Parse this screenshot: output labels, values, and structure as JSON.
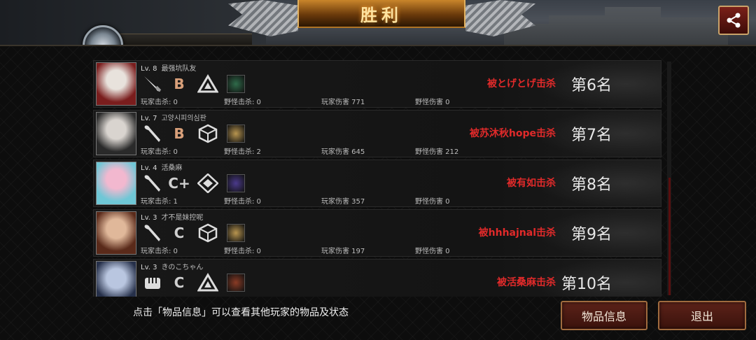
{
  "header": {
    "title": "胜利",
    "share_icon": "share-icon",
    "plate_text": "+ 胜利"
  },
  "colors": {
    "killer_text": "#e02a2a",
    "title_glow": "#ff9d2a",
    "button_bg": "#5c2219"
  },
  "players": [
    {
      "level": "Lv. 8",
      "name": "最强坑队友",
      "weapon": "knife-icon",
      "grade": "B",
      "trait": "triangle-trait-icon",
      "skill_color": "#2f6b4a",
      "player_kills": "玩家击杀: 0",
      "monster_kills": "野怪击杀: 0",
      "player_damage": "玩家伤害 771",
      "monster_damage": "野怪伤害 0",
      "killed_by": "被とげとげ击杀",
      "rank": "第6名"
    },
    {
      "level": "Lv. 7",
      "name": "고양시피의심판",
      "weapon": "bat-icon",
      "grade": "B",
      "trait": "cube-trait-icon",
      "skill_color": "#b8954f",
      "player_kills": "玩家击杀: 0",
      "monster_kills": "野怪击杀: 2",
      "player_damage": "玩家伤害 645",
      "monster_damage": "野怪伤害 212",
      "killed_by": "被苏沐秋hope击杀",
      "rank": "第7名"
    },
    {
      "level": "Lv. 4",
      "name": "活桑麻",
      "weapon": "bat-icon",
      "grade": "C+",
      "trait": "diamond-trait-icon",
      "skill_color": "#4b3a8c",
      "player_kills": "玩家击杀: 1",
      "monster_kills": "野怪击杀: 0",
      "player_damage": "玩家伤害 357",
      "monster_damage": "野怪伤害 0",
      "killed_by": "被有如击杀",
      "rank": "第8名"
    },
    {
      "level": "Lv. 3",
      "name": "才不是妹控呢",
      "weapon": "bat-icon",
      "grade": "C",
      "trait": "cube-trait-icon",
      "skill_color": "#b8954f",
      "player_kills": "玩家击杀: 0",
      "monster_kills": "野怪击杀: 0",
      "player_damage": "玩家伤害 197",
      "monster_damage": "野怪伤害 0",
      "killed_by": "被hhhajnal击杀",
      "rank": "第9名"
    },
    {
      "level": "Lv. 3",
      "name": "きのこちゃん",
      "weapon": "fist-icon",
      "grade": "C",
      "trait": "triangle-trait-icon",
      "skill_color": "#8a3b25",
      "player_kills": "",
      "monster_kills": "",
      "player_damage": "",
      "monster_damage": "",
      "killed_by": "被活桑麻击杀",
      "rank": "第10名"
    }
  ],
  "footer": {
    "hint": "点击「物品信息」可以查看其他玩家的物品及状态",
    "items_button": "物品信息",
    "exit_button": "退出"
  },
  "scroll": {
    "position": 0.5
  }
}
